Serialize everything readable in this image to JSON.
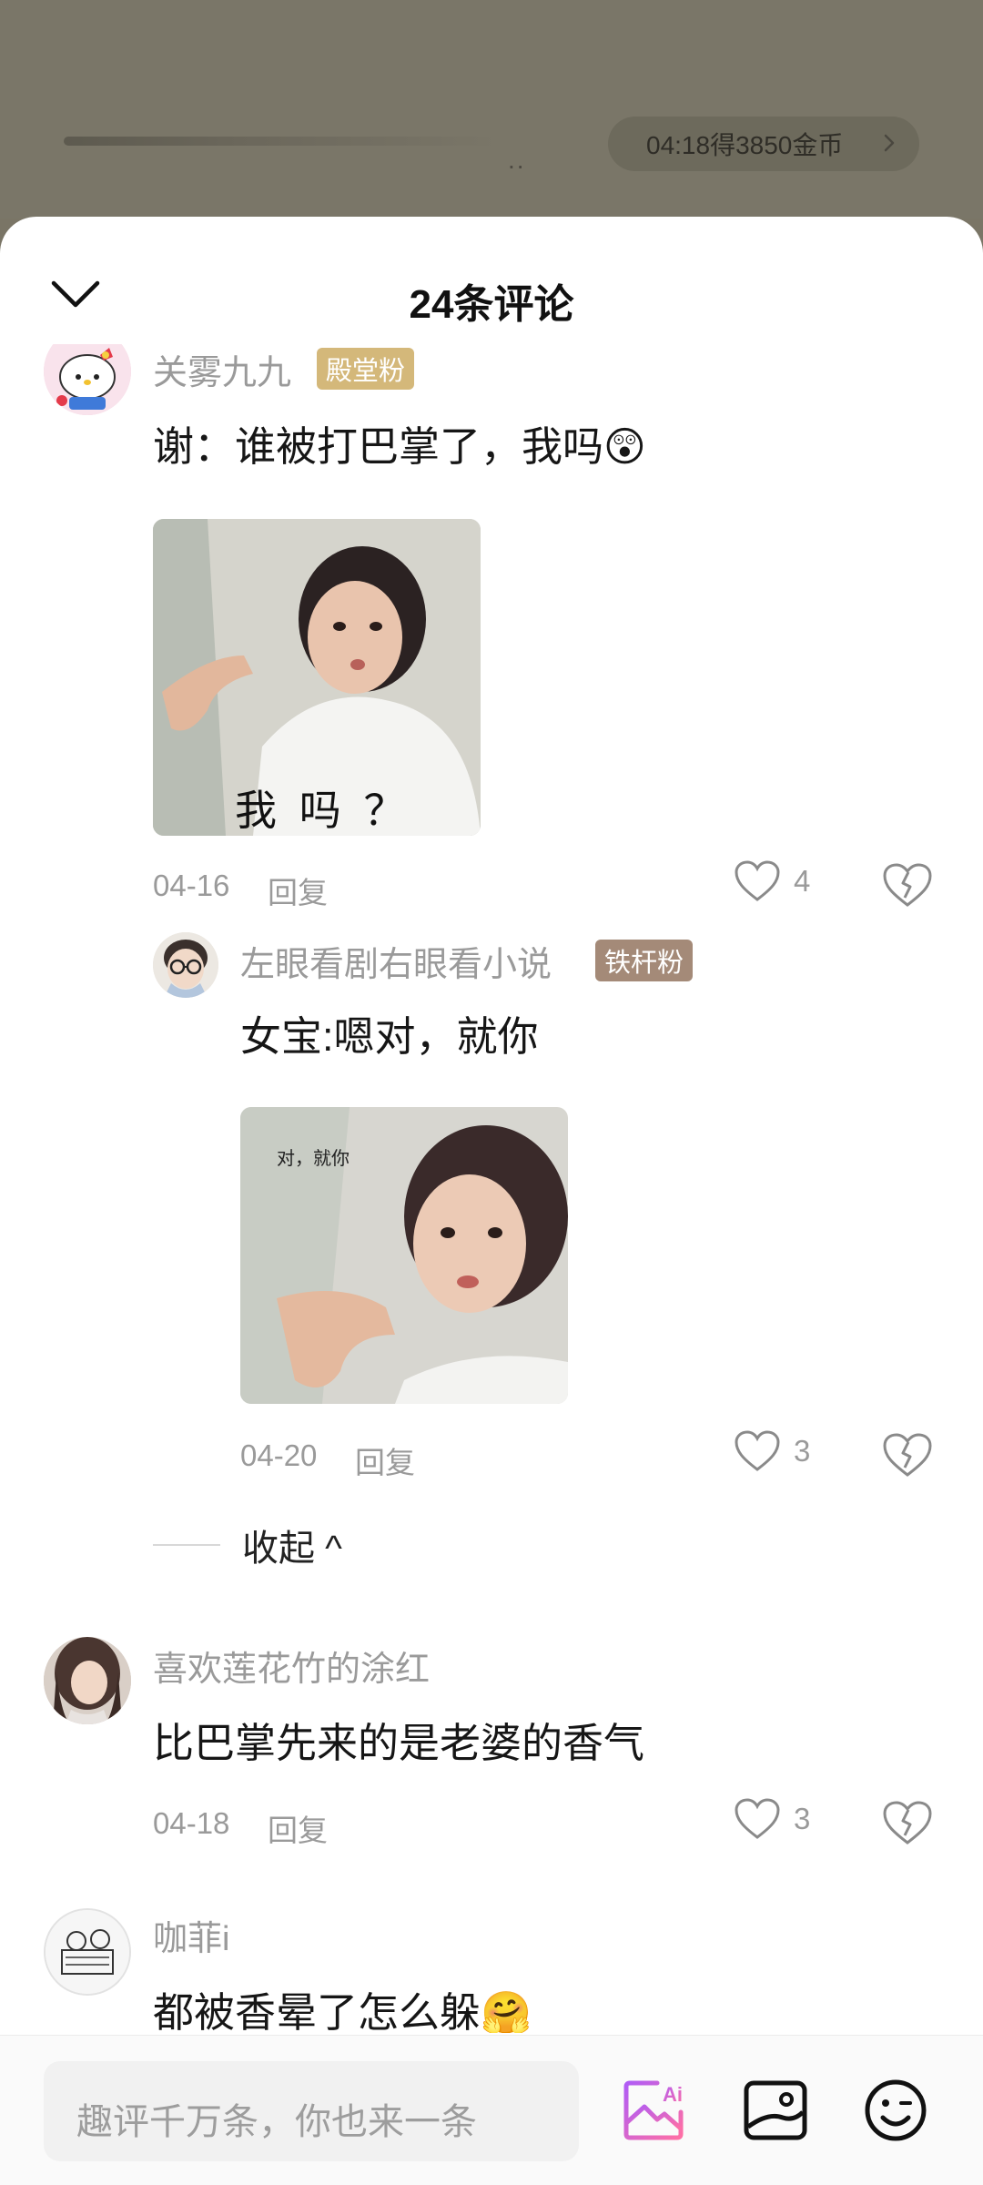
{
  "player": {
    "coin_text": "04:18得3850金币",
    "dots": ".."
  },
  "sheet": {
    "title": "24条评论"
  },
  "comments": [
    {
      "username": "关雾九九",
      "badge": "殿堂粉",
      "badge_color": "#d4b87a",
      "text": "谢：谁被打巴掌了，我吗😲",
      "image_caption": "我 吗 ？",
      "date": "04-16",
      "reply_label": "回复",
      "likes": "4",
      "replies": [
        {
          "username": "左眼看剧右眼看小说",
          "badge": "铁杆粉",
          "badge_color": "#a48a78",
          "text": "女宝:嗯对，就你",
          "image_caption": "对，就你",
          "date": "04-20",
          "reply_label": "回复",
          "likes": "3"
        }
      ],
      "collapse_label": "收起 ^"
    },
    {
      "username": "喜欢莲花竹的涂红",
      "text": "比巴掌先来的是老婆的香气",
      "date": "04-18",
      "reply_label": "回复",
      "likes": "3"
    },
    {
      "username": "咖菲i",
      "text": "都被香晕了怎么躲🤗"
    }
  ],
  "bottom_bar": {
    "input_placeholder": "趣评千万条，你也来一条",
    "icons": [
      "ai-draw-icon",
      "image-icon",
      "emoji-icon"
    ],
    "ai_colors": [
      "#b05cf5",
      "#ff6fa5"
    ]
  }
}
